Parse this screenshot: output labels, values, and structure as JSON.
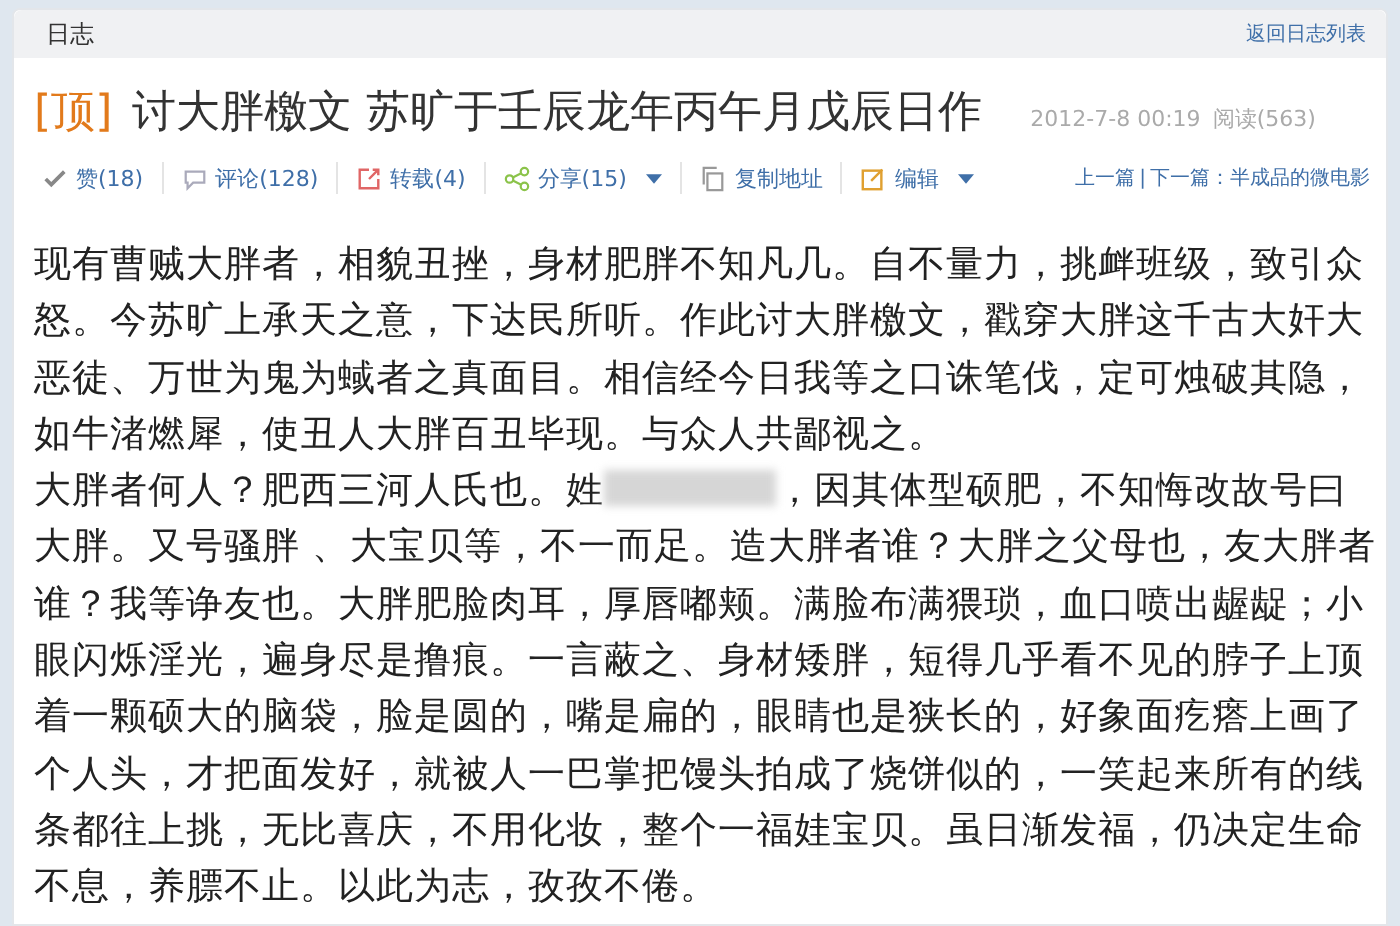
{
  "header": {
    "title": "日志",
    "back_link": "返回日志列表"
  },
  "post": {
    "pin_tag": "[顶]",
    "title": "讨大胖檄文 苏旷于壬辰龙年丙午月戊辰日作",
    "date": "2012-7-8 00:19",
    "reads": "阅读(563)"
  },
  "toolbar": [
    {
      "kind": "like",
      "label": "赞(18)",
      "dropdown": false
    },
    {
      "kind": "comment",
      "label": "评论(128)",
      "dropdown": false
    },
    {
      "kind": "repost",
      "label": "转载(4)",
      "dropdown": false
    },
    {
      "kind": "share",
      "label": "分享(15)",
      "dropdown": true
    },
    {
      "kind": "copy",
      "label": "复制地址",
      "dropdown": false
    },
    {
      "kind": "edit",
      "label": "编辑",
      "dropdown": true
    }
  ],
  "nav": {
    "prev": "上一篇",
    "separator": "|",
    "next": "下一篇：半成品的微电影"
  },
  "paragraphs": [
    {
      "text": "现有曹贼大胖者，相貌丑挫，身材肥胖不知凡几。自不量力，挑衅班级，致引众怒。今苏旷上承天之意，下达民所听。作此讨大胖檄文，戳穿大胖这千古大奸大恶徒、万世为鬼为蜮者之真面目。相信经今日我等之口诛笔伐，定可烛破其隐，如牛渚燃犀，使丑人大胖百丑毕现。与众人共鄙视之。"
    },
    {
      "text": "大胖者何人？肥西三河人氏也。姓",
      "redacted": true,
      "after": "，因其体型硕肥，不知悔改故号曰大胖。又号骚胖 、大宝贝等，不一而足。造大胖者谁？大胖之父母也，友大胖者谁？我等诤友也。大胖肥脸肉耳，厚唇嘟颊。满脸布满猥琐，血口喷出龌龊；小眼闪烁淫光，遍身尽是撸痕。一言蔽之、身材矮胖，短得几乎看不见的脖子上顶着一颗硕大的脑袋，脸是圆的，嘴是扁的，眼睛也是狭长的，好象面疙瘩上画了个人头，才把面发好，就被人一巴掌把馒头拍成了烧饼似的，一笑起来所有的线条都往上挑，无比喜庆，不用化妆，整个一福娃宝贝。虽日渐发福，仍决定生命不息，养膘不止。以此为志，孜孜不倦。"
    }
  ]
}
